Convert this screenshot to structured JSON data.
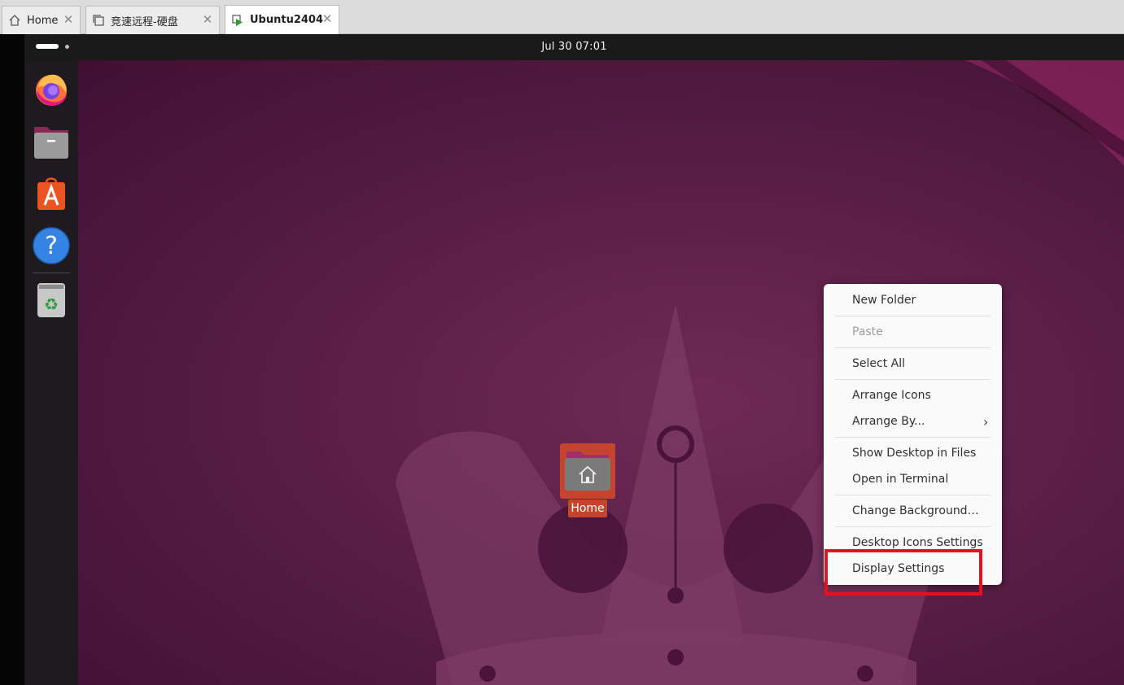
{
  "tabs": [
    {
      "label": "Home",
      "icon": "home-icon"
    },
    {
      "label": "竞速远程-硬盘",
      "icon": "vm-copy-icon"
    },
    {
      "label": "Ubuntu2404",
      "icon": "vm-running-icon",
      "active": true
    }
  ],
  "topbar": {
    "clock": "Jul 30  07:01"
  },
  "dock": {
    "items": [
      {
        "name": "firefox",
        "icon": "firefox-icon"
      },
      {
        "name": "files",
        "icon": "files-icon"
      },
      {
        "name": "app-center",
        "icon": "app-center-icon"
      },
      {
        "name": "help",
        "icon": "help-icon"
      },
      {
        "name": "trash",
        "icon": "trash-icon"
      }
    ]
  },
  "desktop": {
    "home_label": "Home"
  },
  "context_menu": {
    "items": [
      {
        "label": "New Folder",
        "enabled": true
      },
      {
        "label": "Paste",
        "enabled": false
      },
      {
        "label": "Select All",
        "enabled": true
      },
      {
        "label": "Arrange Icons",
        "enabled": true
      },
      {
        "label": "Arrange By...",
        "enabled": true,
        "submenu": true
      },
      {
        "label": "Show Desktop in Files",
        "enabled": true
      },
      {
        "label": "Open in Terminal",
        "enabled": true
      },
      {
        "label": "Change Background…",
        "enabled": true
      },
      {
        "label": "Desktop Icons Settings",
        "enabled": true
      },
      {
        "label": "Display Settings",
        "enabled": true
      }
    ]
  },
  "colors": {
    "highlight_box": "#e8101e",
    "desktop_bg": "#5a1e46",
    "home_icon_bg": "#c4442d"
  }
}
